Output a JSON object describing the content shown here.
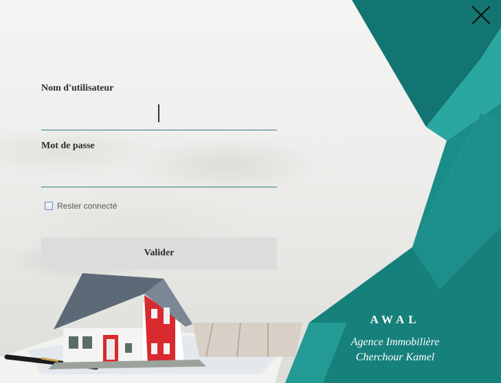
{
  "form": {
    "username_label": "Nom d'utilisateur",
    "username_value": "",
    "password_label": "Mot de passe",
    "password_value": "",
    "remember_label": "Rester connecté",
    "remember_checked": false,
    "submit_label": "Valider"
  },
  "brand": {
    "name": "AWAL",
    "line1": "Agence Immobilière",
    "line2": "Cherchour Kamel"
  },
  "icons": {
    "close": "close-icon",
    "house": "house-illustration"
  },
  "colors": {
    "teal_dark": "#127571",
    "teal_mid": "#1a8d88",
    "teal_light": "#2aa7a0",
    "accent_line": "#2e7f86",
    "house_roof": "#5c6a78",
    "house_door": "#d82a2f"
  }
}
